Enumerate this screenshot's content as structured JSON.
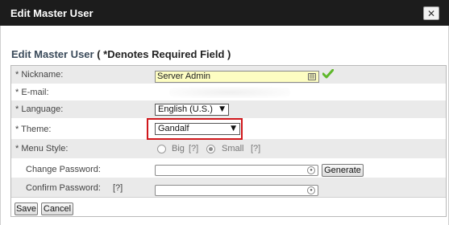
{
  "window": {
    "title": "Edit Master User",
    "close_glyph": "✕"
  },
  "section": {
    "heading": "Edit Master User",
    "required_note": "( *Denotes Required Field )"
  },
  "fields": {
    "nickname": {
      "label": "* Nickname:",
      "value": "Server Admin",
      "icon": "field-icon",
      "status_icon": "check-icon"
    },
    "email": {
      "label": "* E-mail:"
    },
    "language": {
      "label": "* Language:",
      "selected": "English (U.S.)"
    },
    "theme": {
      "label": "* Theme:",
      "selected": "Gandalf"
    },
    "menu_style": {
      "label": "* Menu Style:",
      "option_big": "Big",
      "option_big_help": "[?]",
      "option_small": "Small",
      "option_small_help": "[?]",
      "selected": "Small"
    },
    "change_password": {
      "label": "Change Password:",
      "generate_label": "Generate"
    },
    "confirm_password": {
      "label": "Confirm Password:",
      "help": "[?]"
    }
  },
  "actions": {
    "save_label": "Save",
    "cancel_label": "Cancel"
  },
  "colors": {
    "titlebar": "#1c1c1c",
    "highlight": "#d0181c",
    "nickname_bg": "#fdfdc2",
    "check": "#5fb82b"
  }
}
